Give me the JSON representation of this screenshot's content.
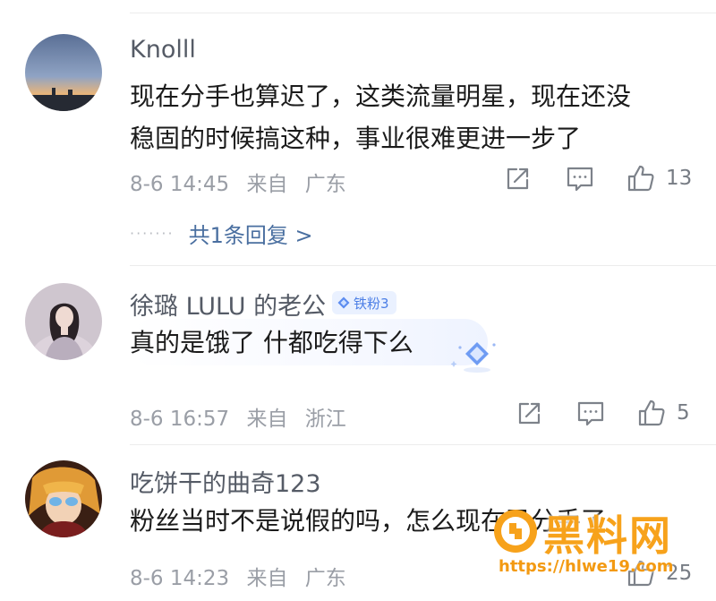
{
  "colors": {
    "accent": "#4a6fa0",
    "meta": "#9a9ea6",
    "badge": "#4c7fe6",
    "watermark": "#f7a21b"
  },
  "comments": [
    {
      "username": "Knolll",
      "lines": [
        "现在分手也算迟了，这类流量明星，现在还没",
        "稳固的时候搞这种，事业很难更进一步了"
      ],
      "time": "8-6 14:45",
      "from": "来自",
      "location": "广东",
      "likes": "13",
      "replies_label": "共1条回复 >"
    },
    {
      "username": "徐璐 LULU 的老公",
      "badge": "铁粉3",
      "lines": [
        "真的是饿了 什都吃得下么"
      ],
      "time": "8-6 16:57",
      "from": "来自",
      "location": "浙江",
      "likes": "5"
    },
    {
      "username": "吃饼干的曲奇123",
      "lines": [
        "粉丝当时不是说假的吗，怎么现在已分手了"
      ],
      "time": "8-6 14:23",
      "from": "来自",
      "location": "广东",
      "likes": "25"
    }
  ],
  "icons": {
    "share": "share-icon",
    "comment": "comment-icon",
    "like": "thumbs-up-icon"
  },
  "watermark": {
    "text": "黑料网",
    "url": "https://hlwe19.com"
  }
}
